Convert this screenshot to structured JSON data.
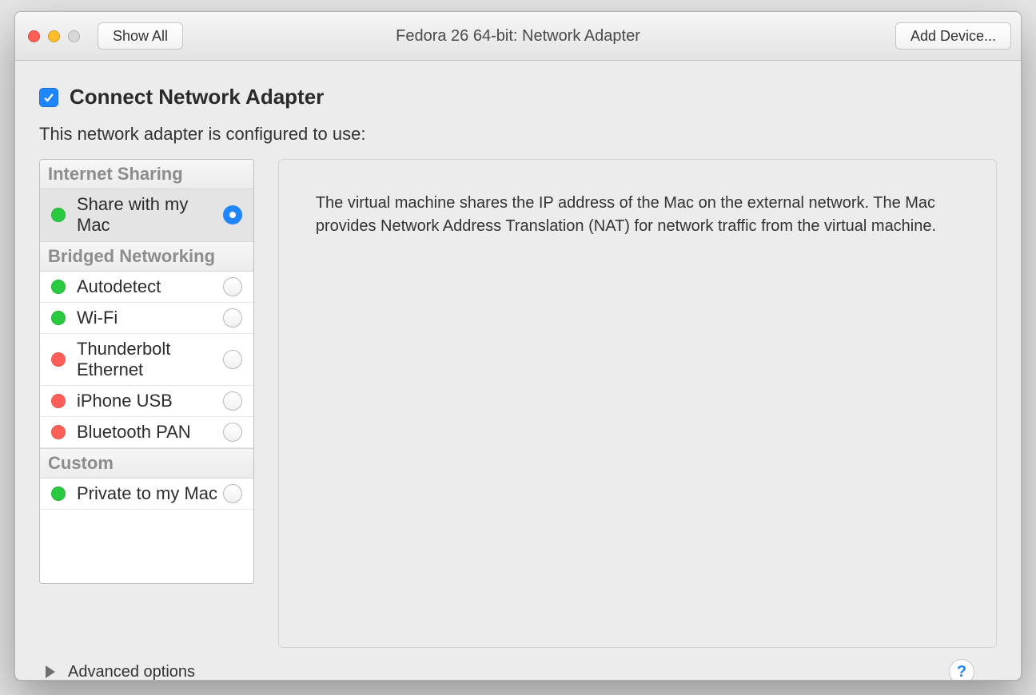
{
  "titlebar": {
    "show_all": "Show All",
    "title": "Fedora 26 64-bit: Network Adapter",
    "add_device": "Add Device..."
  },
  "connect": {
    "label": "Connect Network Adapter",
    "checked": true
  },
  "subhead": "This network adapter is configured to use:",
  "groups": [
    {
      "name": "Internet Sharing",
      "items": [
        {
          "label": "Share with my Mac",
          "status": "green",
          "selected": true
        }
      ]
    },
    {
      "name": "Bridged Networking",
      "items": [
        {
          "label": "Autodetect",
          "status": "green",
          "selected": false
        },
        {
          "label": "Wi-Fi",
          "status": "green",
          "selected": false
        },
        {
          "label": "Thunderbolt Ethernet",
          "status": "red",
          "selected": false
        },
        {
          "label": "iPhone USB",
          "status": "red",
          "selected": false
        },
        {
          "label": "Bluetooth PAN",
          "status": "red",
          "selected": false
        }
      ]
    },
    {
      "name": "Custom",
      "items": [
        {
          "label": "Private to my Mac",
          "status": "green",
          "selected": false
        }
      ]
    }
  ],
  "description": "The virtual machine shares the IP address of the Mac on the external network. The Mac provides Network Address Translation (NAT) for network traffic from the virtual machine.",
  "advanced": "Advanced options",
  "help": "?",
  "colors": {
    "accent": "#1f86ff"
  }
}
